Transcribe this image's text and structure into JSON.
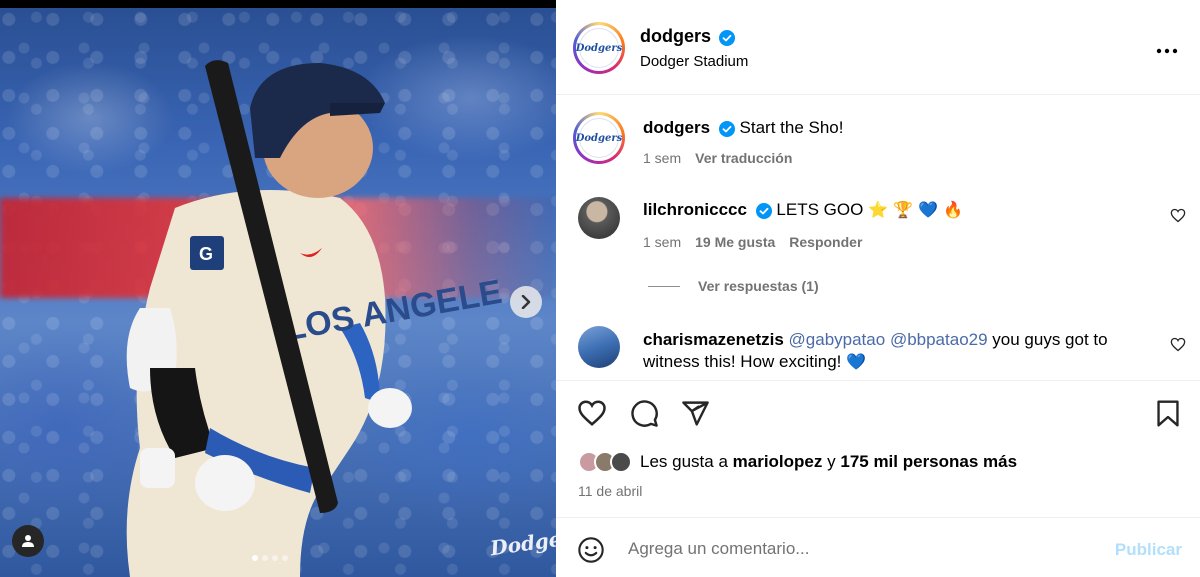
{
  "post": {
    "author": "dodgers",
    "location": "Dodger Stadium",
    "logo_text": "Dodgers",
    "watermark": "Dodgers",
    "image_dots": 4,
    "active_dot": 0,
    "caption": {
      "username": "dodgers",
      "text": "Start the Sho!",
      "time": "1 sem",
      "translate": "Ver traducción"
    }
  },
  "comments": [
    {
      "username": "lilchronicccc",
      "verified": true,
      "text": "LETS GOO",
      "emoji": "⭐ 🏆 💙 🔥",
      "time": "1 sem",
      "likes": "19 Me gusta",
      "reply": "Responder",
      "view_replies": "Ver respuestas (1)"
    },
    {
      "username": "charismazenetzis",
      "verified": false,
      "mention1": "@gabypatao",
      "mention2": "@bbpatao29",
      "text_line1": "you guys got to",
      "text_line2": "witness this! How exciting!",
      "emoji": "💙"
    }
  ],
  "likes": {
    "prefix": "Les gusta a",
    "user": "mariolopez",
    "conj": "y",
    "others": "175 mil personas más"
  },
  "date": "11 de abril",
  "add_comment": {
    "placeholder": "Agrega un comentario...",
    "publish": "Publicar"
  },
  "icons": {
    "like": "heart-icon",
    "comment": "comment-icon",
    "share": "share-icon",
    "save": "bookmark-icon",
    "more": "more-icon",
    "emoji": "emoji-icon",
    "verified": "verified-badge-icon",
    "next": "chevron-right-icon",
    "user_tag": "user-tag-icon"
  },
  "colors": {
    "verified": "#0095f6",
    "muted": "#737373",
    "mention": "#4a6ba7",
    "publish_disabled": "#b2dffc",
    "dodger_blue": "#1e4fa0"
  }
}
